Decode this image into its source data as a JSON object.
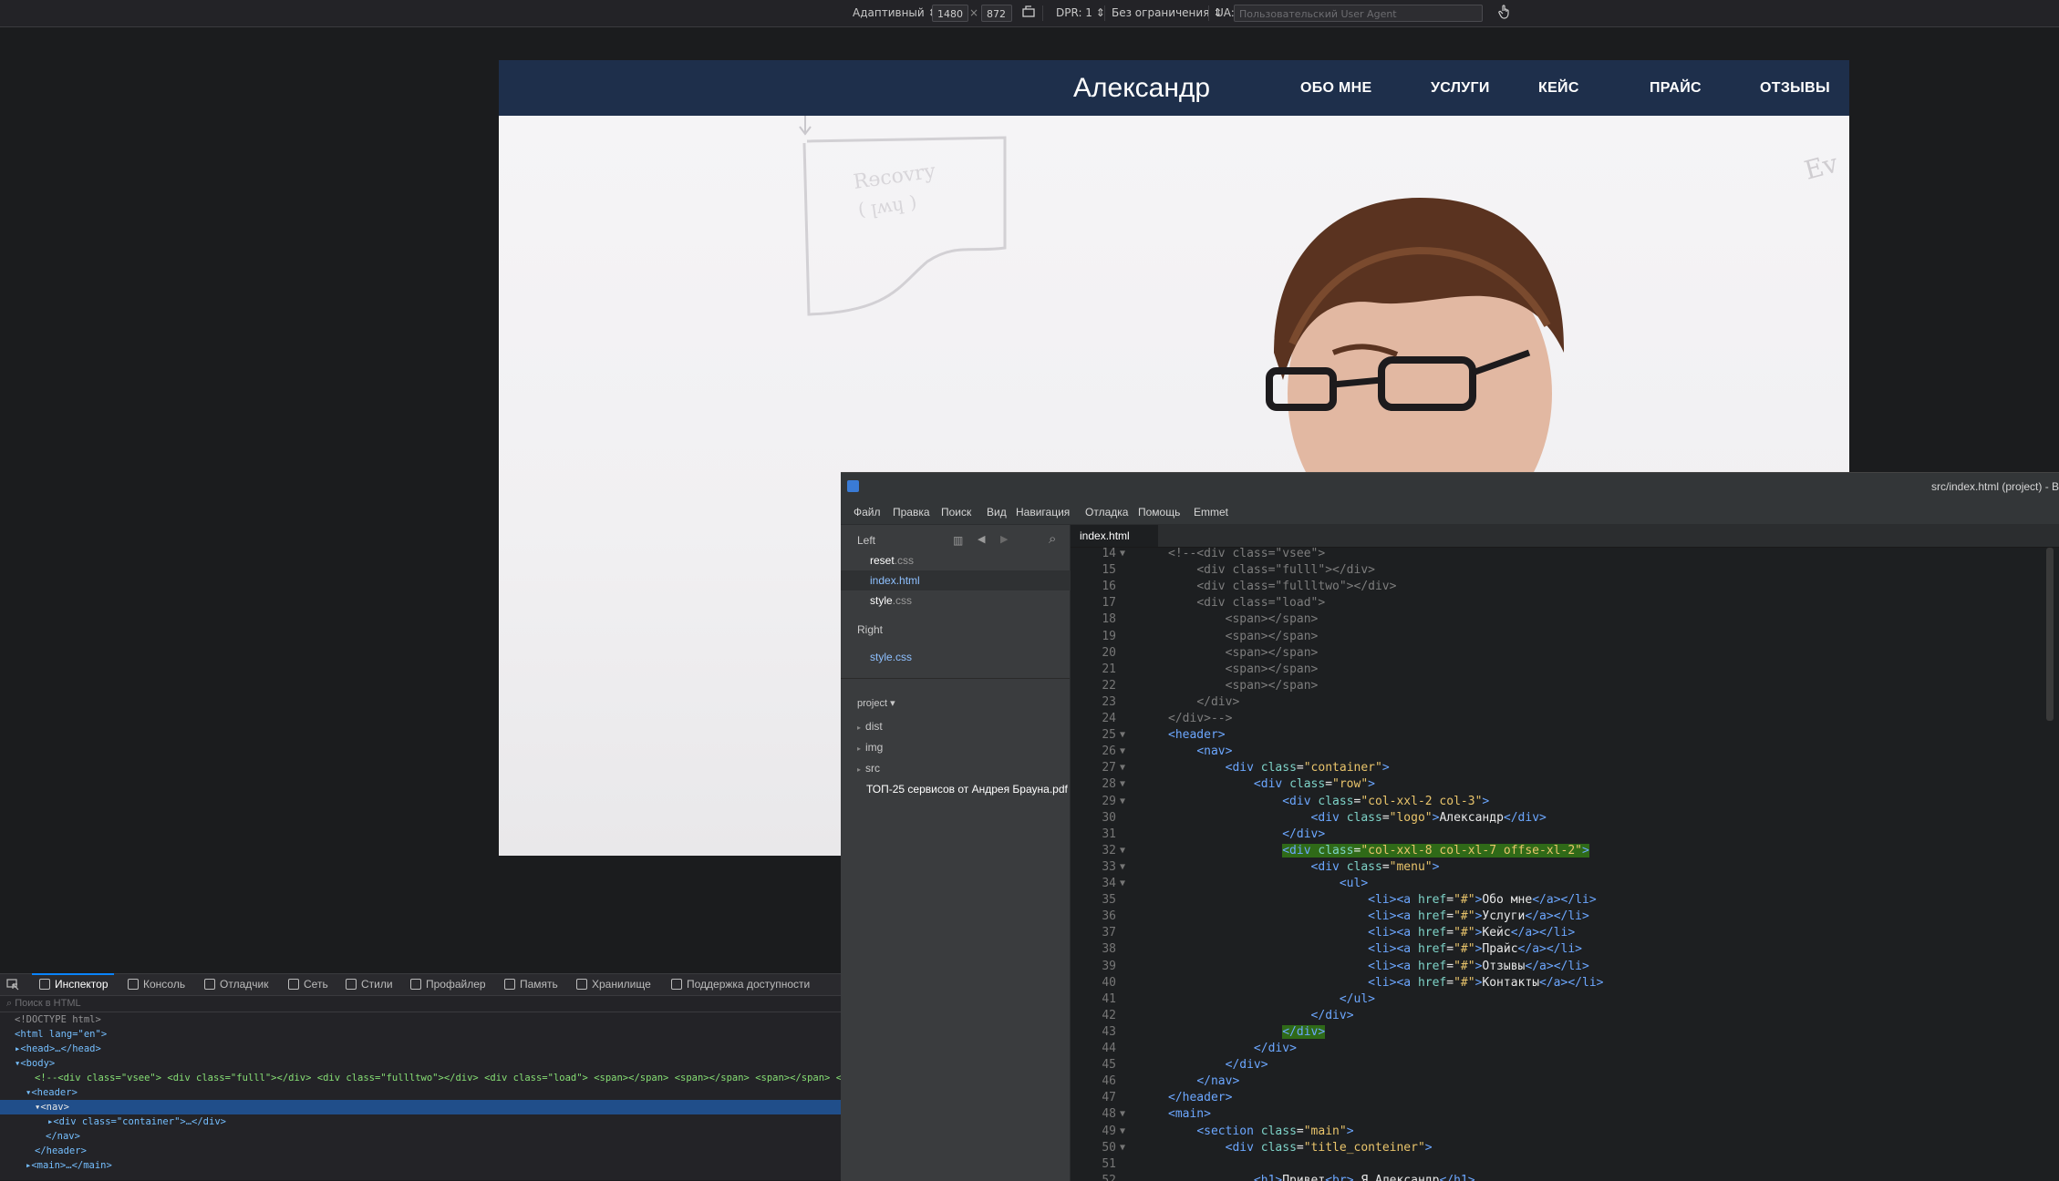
{
  "toolbar": {
    "device": "Адаптивный",
    "width": "1480",
    "times": "×",
    "height": "872",
    "dpr": "DPR: 1",
    "throttle": "Без ограничения",
    "ua_label": "UA:",
    "ua_placeholder": "Пользовательский User Agent"
  },
  "site": {
    "logo": "Александр",
    "nav": [
      "ОБО МНЕ",
      "УСЛУГИ",
      "КЕЙС",
      "ПРАЙС",
      "ОТЗЫВЫ"
    ]
  },
  "devtools": {
    "tabs": [
      "Инспектор",
      "Консоль",
      "Отладчик",
      "Сеть",
      "Стили",
      "Профайлер",
      "Память",
      "Хранилище",
      "Поддержка доступности"
    ],
    "search_placeholder": "Поиск в HTML",
    "tree": [
      {
        "t": "<!DOCTYPE html>"
      },
      {
        "t": "<html lang=\"en\">"
      },
      {
        "t": "▸<head>…</head>"
      },
      {
        "t": "▾<body>"
      },
      {
        "t": "<!--<div class=\"vsee\"> <div class=\"fulll\"></div> <div class=\"fullltwo\"></div> <div class=\"load\"> <span></span> <span></span> <span></span> <span></span>"
      },
      {
        "t": "▾<header>"
      },
      {
        "t": "▾<nav>"
      },
      {
        "t": "▸<div class=\"container\">…</div>"
      },
      {
        "t": "</nav>"
      },
      {
        "t": "</header>"
      },
      {
        "t": "▸<main>…</main>"
      }
    ]
  },
  "editor": {
    "title": "src/index.html (project) - Brackets",
    "menu": [
      "Файл",
      "Правка",
      "Поиск",
      "Вид",
      "Навигация",
      "Отладка",
      "Помощь",
      "Emmet"
    ],
    "sidebar": {
      "left_label": "Left",
      "left_files": [
        {
          "name": "reset",
          "ext": ".css"
        },
        {
          "name": "index.html",
          "ext": ""
        },
        {
          "name": "style",
          "ext": ".css"
        }
      ],
      "right_label": "Right",
      "right_files": [
        {
          "name": "style",
          "ext": ".css"
        }
      ],
      "project_label": "project ▾",
      "folders": [
        "dist",
        "img",
        "src"
      ],
      "extra_item": "ТОП-25 сервисов от Андрея Брауна.pdf"
    },
    "tab": "index.html",
    "code_lines": [
      {
        "n": "14",
        "f": "▼",
        "src": "<!--<div class=\"vsee\">",
        "indent": 0,
        "kind": "comment"
      },
      {
        "n": "15",
        "f": "",
        "src": "    <div class=\"fulll\"></div>",
        "indent": 0,
        "kind": "comment"
      },
      {
        "n": "16",
        "f": "",
        "src": "    <div class=\"fullltwo\"></div>",
        "indent": 0,
        "kind": "comment"
      },
      {
        "n": "17",
        "f": "",
        "src": "    <div class=\"load\">",
        "indent": 0,
        "kind": "comment"
      },
      {
        "n": "18",
        "f": "",
        "src": "        <span></span>",
        "indent": 0,
        "kind": "comment"
      },
      {
        "n": "19",
        "f": "",
        "src": "        <span></span>",
        "indent": 0,
        "kind": "comment"
      },
      {
        "n": "20",
        "f": "",
        "src": "        <span></span>",
        "indent": 0,
        "kind": "comment"
      },
      {
        "n": "21",
        "f": "",
        "src": "        <span></span>",
        "indent": 0,
        "kind": "comment"
      },
      {
        "n": "22",
        "f": "",
        "src": "        <span></span>",
        "indent": 0,
        "kind": "comment"
      },
      {
        "n": "23",
        "f": "",
        "src": "    </div>",
        "indent": 0,
        "kind": "comment"
      },
      {
        "n": "24",
        "f": "",
        "src": "</div>-->",
        "indent": 0,
        "kind": "comment"
      },
      {
        "n": "25",
        "f": "▼",
        "src": "<header>",
        "indent": 0,
        "kind": "code"
      },
      {
        "n": "26",
        "f": "▼",
        "src": "    <nav>",
        "indent": 0,
        "kind": "code"
      },
      {
        "n": "27",
        "f": "▼",
        "src": "        <div class=\"container\">",
        "indent": 0,
        "kind": "code"
      },
      {
        "n": "28",
        "f": "▼",
        "src": "            <div class=\"row\">",
        "indent": 0,
        "kind": "code"
      },
      {
        "n": "29",
        "f": "▼",
        "src": "                <div class=\"col-xxl-2 col-3\">",
        "indent": 0,
        "kind": "code"
      },
      {
        "n": "30",
        "f": "",
        "src": "                    <div class=\"logo\">Александр</div>",
        "indent": 0,
        "kind": "code"
      },
      {
        "n": "31",
        "f": "",
        "src": "                </div>",
        "indent": 0,
        "kind": "code"
      },
      {
        "n": "32",
        "f": "▼",
        "src": "                <div class=\"col-xxl-8 col-xl-7 offse-xl-2\">",
        "indent": 0,
        "kind": "highlight"
      },
      {
        "n": "33",
        "f": "▼",
        "src": "                    <div class=\"menu\">",
        "indent": 0,
        "kind": "code"
      },
      {
        "n": "34",
        "f": "▼",
        "src": "                        <ul>",
        "indent": 0,
        "kind": "code"
      },
      {
        "n": "35",
        "f": "",
        "src": "                            <li><a href=\"#\">Обо мне</a></li>",
        "indent": 0,
        "kind": "code"
      },
      {
        "n": "36",
        "f": "",
        "src": "                            <li><a href=\"#\">Услуги</a></li>",
        "indent": 0,
        "kind": "code"
      },
      {
        "n": "37",
        "f": "",
        "src": "                            <li><a href=\"#\">Кейс</a></li>",
        "indent": 0,
        "kind": "code"
      },
      {
        "n": "38",
        "f": "",
        "src": "                            <li><a href=\"#\">Прайс</a></li>",
        "indent": 0,
        "kind": "code"
      },
      {
        "n": "39",
        "f": "",
        "src": "                            <li><a href=\"#\">Отзывы</a></li>",
        "indent": 0,
        "kind": "code"
      },
      {
        "n": "40",
        "f": "",
        "src": "                            <li><a href=\"#\">Контакты</a></li>",
        "indent": 0,
        "kind": "code"
      },
      {
        "n": "41",
        "f": "",
        "src": "                        </ul>",
        "indent": 0,
        "kind": "code"
      },
      {
        "n": "42",
        "f": "",
        "src": "                    </div>",
        "indent": 0,
        "kind": "code"
      },
      {
        "n": "43",
        "f": "",
        "src": "                </div>",
        "indent": 0,
        "kind": "highlight"
      },
      {
        "n": "44",
        "f": "",
        "src": "            </div>",
        "indent": 0,
        "kind": "code"
      },
      {
        "n": "45",
        "f": "",
        "src": "        </div>",
        "indent": 0,
        "kind": "code"
      },
      {
        "n": "46",
        "f": "",
        "src": "    </nav>",
        "indent": 0,
        "kind": "code"
      },
      {
        "n": "47",
        "f": "",
        "src": "</header>",
        "indent": 0,
        "kind": "code"
      },
      {
        "n": "48",
        "f": "▼",
        "src": "<main>",
        "indent": 0,
        "kind": "code"
      },
      {
        "n": "49",
        "f": "▼",
        "src": "    <section class=\"main\">",
        "indent": 0,
        "kind": "code"
      },
      {
        "n": "50",
        "f": "▼",
        "src": "        <div class=\"title_conteiner\">",
        "indent": 0,
        "kind": "code"
      },
      {
        "n": "51",
        "f": "",
        "src": "",
        "indent": 0,
        "kind": "code"
      },
      {
        "n": "52",
        "f": "",
        "src": "            <h1>Привет<br> Я Александр</h1>",
        "indent": 0,
        "kind": "code"
      }
    ]
  },
  "colors": {
    "site_header": "#1e2f4b",
    "highlight": "#2f6a18",
    "selection": "#204e8a",
    "accent": "#0a84ff"
  }
}
